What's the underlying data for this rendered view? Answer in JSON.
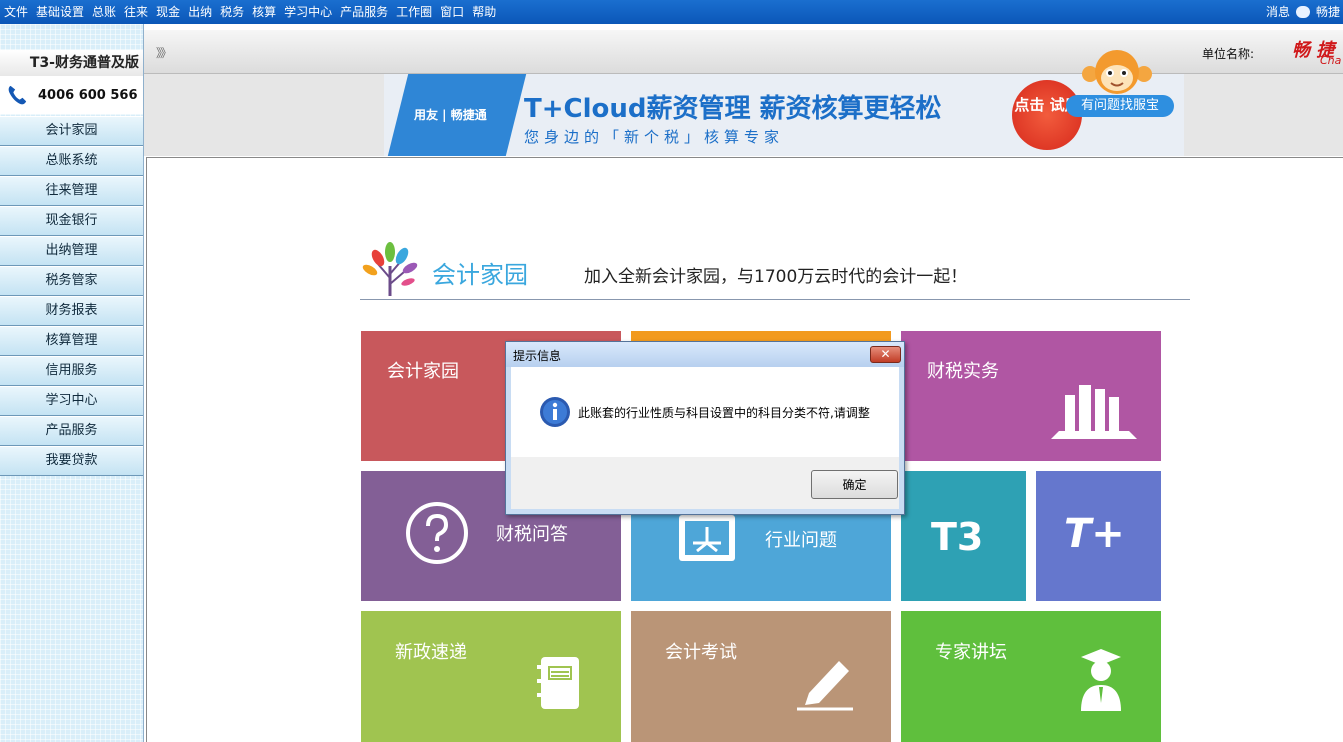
{
  "menubar": {
    "items": [
      "文件",
      "基础设置",
      "总账",
      "往来",
      "现金",
      "出纳",
      "税务",
      "核算",
      "学习中心",
      "产品服务",
      "工作圈",
      "窗口",
      "帮助"
    ],
    "right_items": [
      "消息",
      "畅捷"
    ]
  },
  "left_panel": {
    "product_name": "T3-财务通普及版",
    "hotline": "4006 600 566",
    "nav_items": [
      "会计家园",
      "总账系统",
      "往来管理",
      "现金银行",
      "出纳管理",
      "税务管家",
      "财务报表",
      "核算管理",
      "信用服务",
      "学习中心",
      "产品服务",
      "我要贷款"
    ]
  },
  "header": {
    "collapse_arrows": "》》",
    "unit_label": "单位名称:",
    "logo_cn": "畅 捷",
    "logo_en": "Cha"
  },
  "banner": {
    "logo_text": "用友 | 畅捷通",
    "title": "T+Cloud薪资管理  薪资核算更轻松",
    "subtitle": "您身边的「新个税」核算专家",
    "cta": "点击 试用",
    "help_badge": "有问题找服宝"
  },
  "home": {
    "title": "会计家园",
    "slogan": "加入全新会计家园，与1700万云时代的会计一起！"
  },
  "tiles": [
    {
      "label": "会计家园",
      "color": "#c8585c"
    },
    {
      "label": "",
      "color": "#f29a1e"
    },
    {
      "label": "财税实务",
      "color": "#b056a3"
    },
    {
      "label": "财税问答",
      "color": "#835f96"
    },
    {
      "label": "行业问题",
      "color": "#4ea6d8"
    },
    {
      "label": "T3",
      "color": "#2ea1b4"
    },
    {
      "label": "T+",
      "color": "#6577cd"
    },
    {
      "label": "新政速递",
      "color": "#a0c450"
    },
    {
      "label": "会计考试",
      "color": "#ba9577"
    },
    {
      "label": "专家讲坛",
      "color": "#5fbf3d"
    }
  ],
  "dialog": {
    "title": "提示信息",
    "close": "✕",
    "message": "此账套的行业性质与科目设置中的科目分类不符,请调整",
    "ok": "确定"
  }
}
